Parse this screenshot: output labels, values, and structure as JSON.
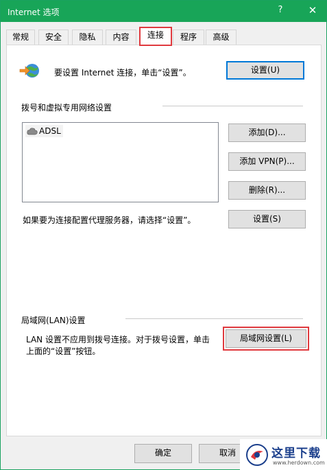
{
  "window": {
    "title": "Internet 选项",
    "help_label": "?",
    "close_label": "✕",
    "accent_color": "#18a558",
    "highlight_color": "#e0393e"
  },
  "tabs": [
    {
      "label": "常规"
    },
    {
      "label": "安全"
    },
    {
      "label": "隐私"
    },
    {
      "label": "内容"
    },
    {
      "label": "连接",
      "active": true
    },
    {
      "label": "程序"
    },
    {
      "label": "高级"
    }
  ],
  "connect": {
    "icon": "network-globe-icon",
    "text": "要设置 Internet 连接，单击“设置”。",
    "setup_button": "设置(U)"
  },
  "dialup": {
    "heading": "拨号和虚拟专用网络设置",
    "connections": [
      {
        "name": "ADSL",
        "icon": "cloud-connection-icon"
      }
    ],
    "add_button": "添加(D)...",
    "add_vpn_button": "添加 VPN(P)...",
    "remove_button": "删除(R)...",
    "proxy_text": "如果要为连接配置代理服务器，请选择“设置”。",
    "settings_button": "设置(S)"
  },
  "lan": {
    "heading": "局域网(LAN)设置",
    "text_line1": "LAN 设置不应用到拨号连接。对于拨号设置，单击",
    "text_line2": "上面的“设置”按钮。",
    "lan_button": "局域网设置(L)"
  },
  "footer": {
    "ok_button": "确定",
    "cancel_button": "取消"
  },
  "watermark": {
    "text": "这里下载",
    "url": "www.herdown.com"
  }
}
